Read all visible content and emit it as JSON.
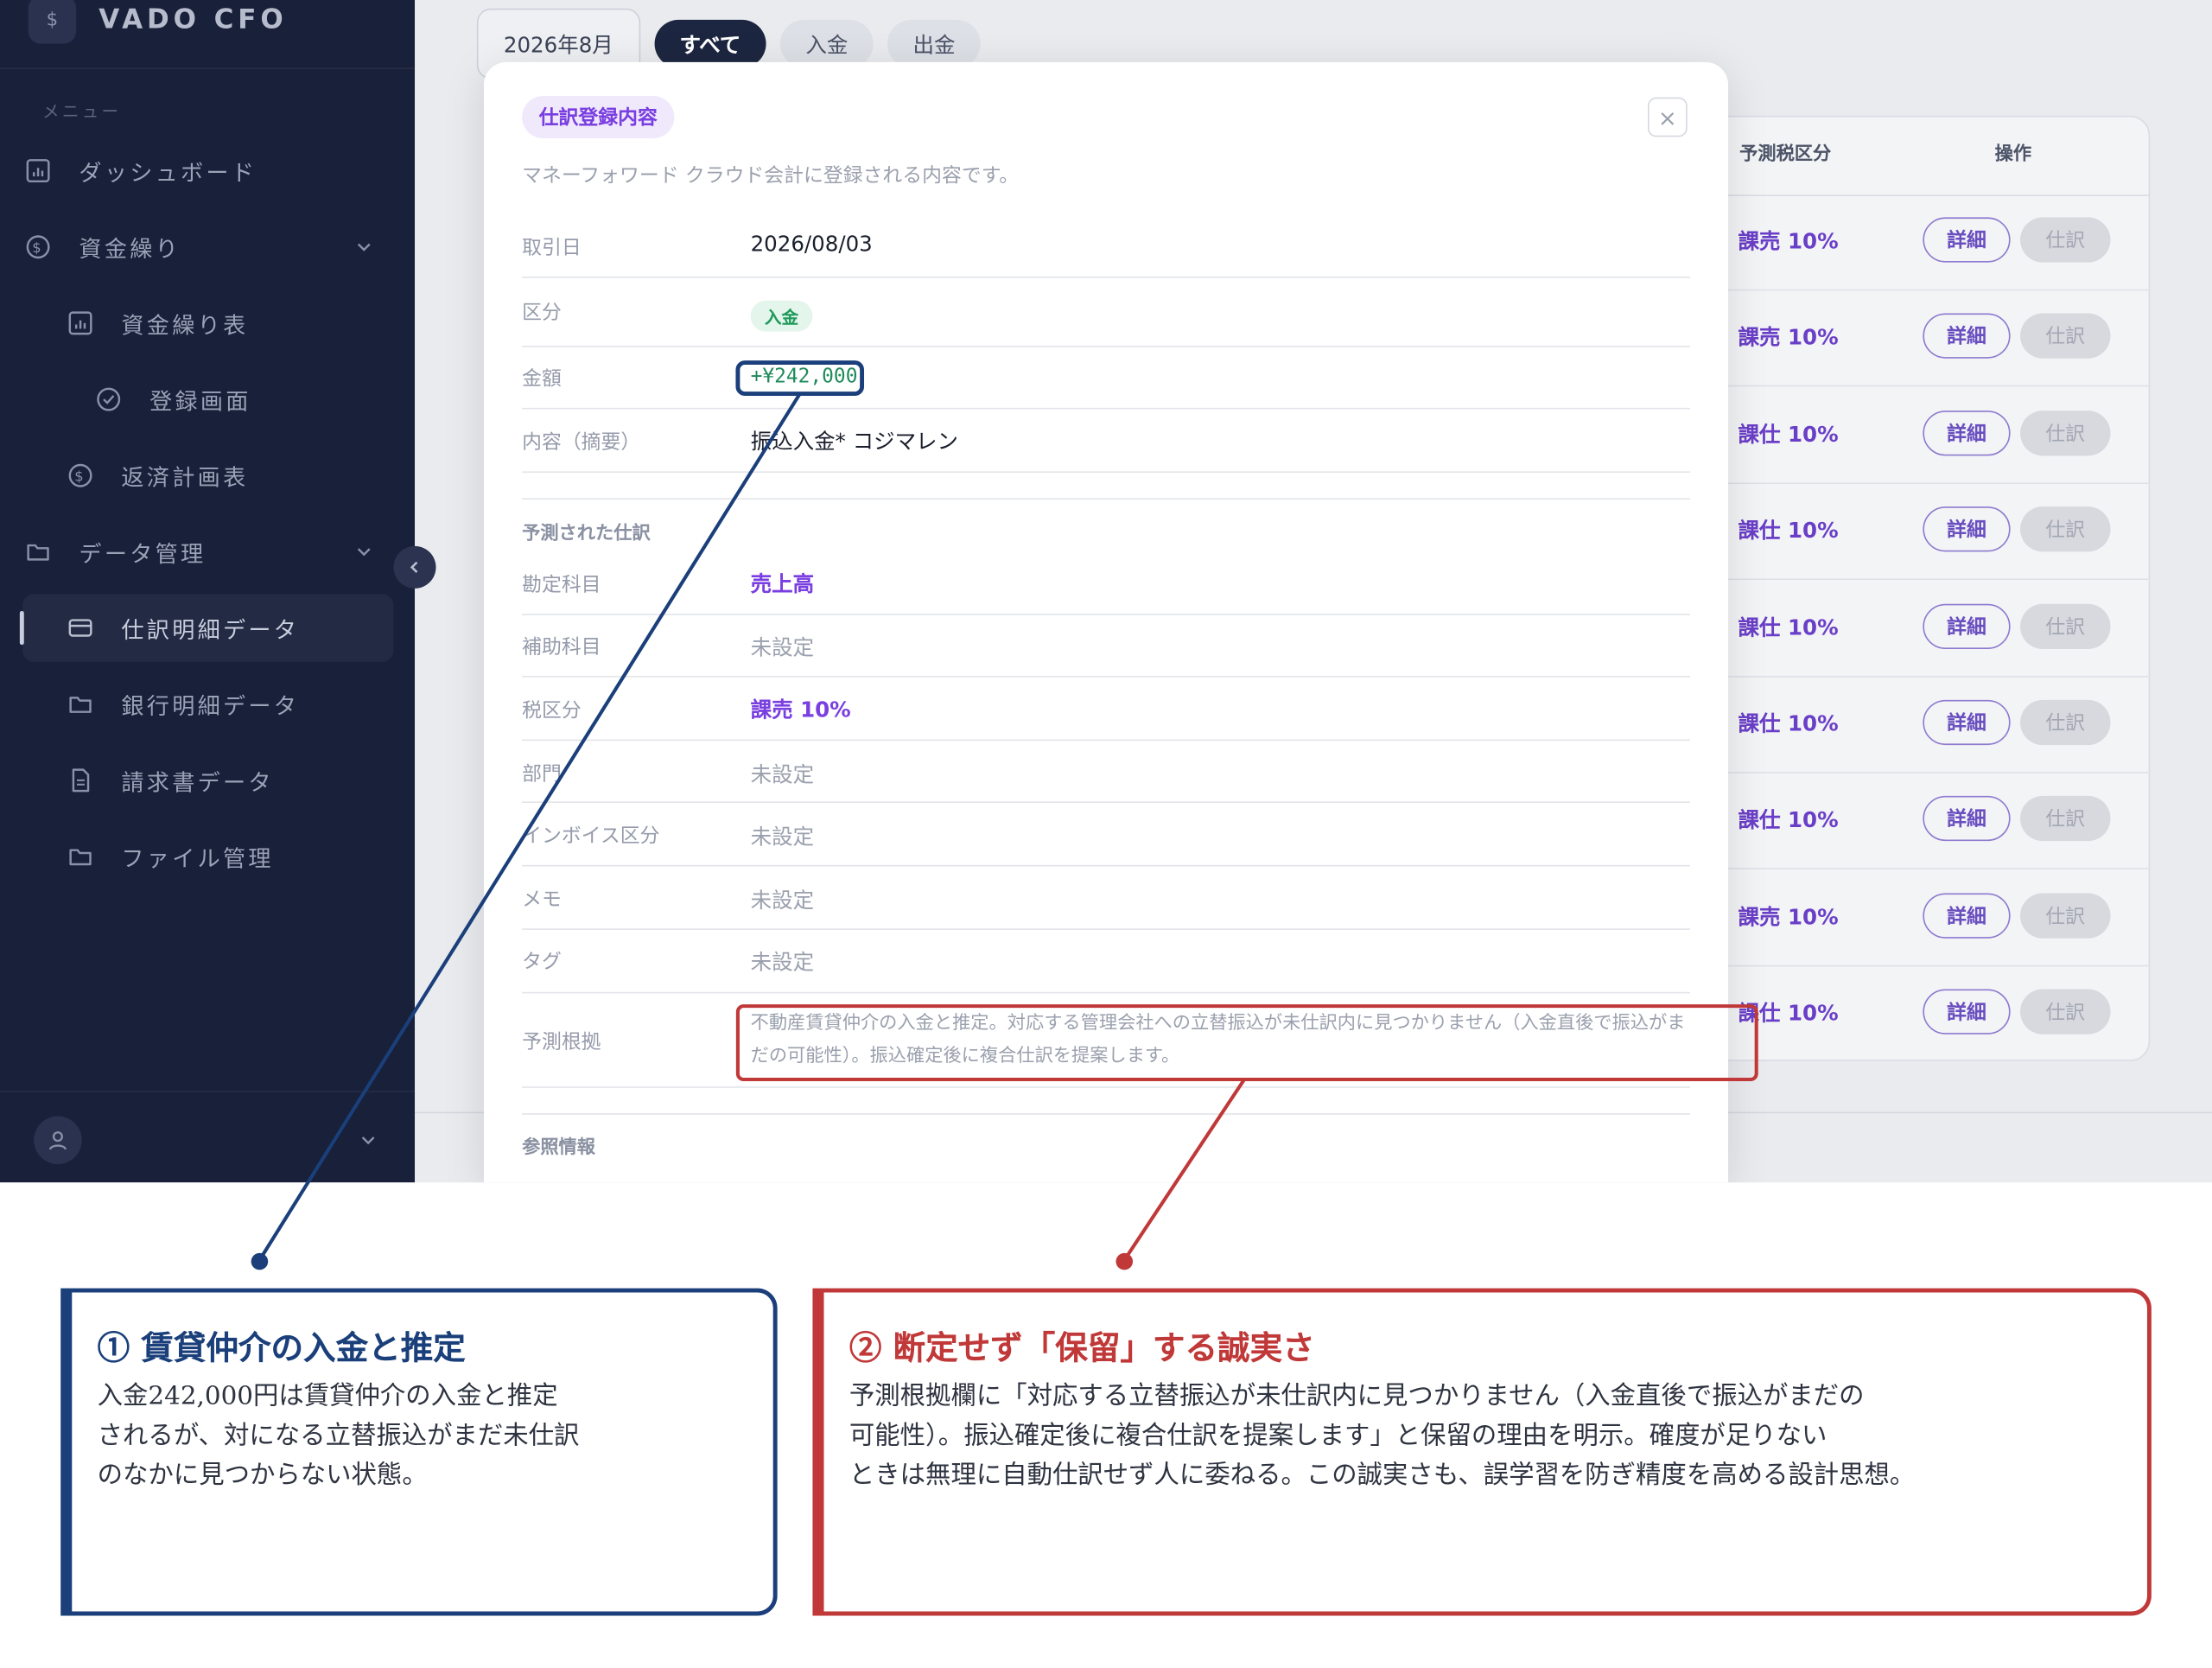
{
  "sidebar": {
    "brand": "VADO CFO",
    "brand_badge": "$",
    "menu_label": "メニュー",
    "items": [
      {
        "label": "ダッシュボード"
      },
      {
        "label": "資金繰り"
      },
      {
        "label": "資金繰り表"
      },
      {
        "label": "登録画面"
      },
      {
        "label": "返済計画表"
      },
      {
        "label": "データ管理"
      },
      {
        "label": "仕訳明細データ"
      },
      {
        "label": "銀行明細データ"
      },
      {
        "label": "請求書データ"
      },
      {
        "label": "ファイル管理"
      }
    ],
    "active_item": "仕訳明細データ"
  },
  "tabs": {
    "month": "2026年8月",
    "filters": [
      "すべて",
      "入金",
      "出金"
    ],
    "selected": "すべて"
  },
  "table": {
    "headers": [
      "予測税区分",
      "操作"
    ],
    "rows": [
      {
        "tax": "課売 10%",
        "detail": "詳細",
        "journal": "仕訳"
      },
      {
        "tax": "課売 10%",
        "detail": "詳細",
        "journal": "仕訳"
      },
      {
        "tax": "課仕 10%",
        "detail": "詳細",
        "journal": "仕訳"
      },
      {
        "tax": "課仕 10%",
        "detail": "詳細",
        "journal": "仕訳"
      },
      {
        "tax": "課仕 10%",
        "detail": "詳細",
        "journal": "仕訳"
      },
      {
        "tax": "課仕 10%",
        "detail": "詳細",
        "journal": "仕訳"
      },
      {
        "tax": "課仕 10%",
        "detail": "詳細",
        "journal": "仕訳"
      },
      {
        "tax": "課売 10%",
        "detail": "詳細",
        "journal": "仕訳"
      },
      {
        "tax": "課仕 10%",
        "detail": "詳細",
        "journal": "仕訳"
      }
    ]
  },
  "modal": {
    "badge": "仕訳登録内容",
    "close": "×",
    "description": "マネーフォワード クラウド会計に登録される内容です。",
    "fields": {
      "date_label": "取引日",
      "date_value": "2026/08/03",
      "kind_label": "区分",
      "kind_value": "入金",
      "amount_label": "金額",
      "amount_value": "+¥242,000",
      "memo_label": "内容（摘要）",
      "memo_value": "振込入金* コジマレン"
    },
    "predicted_section": "予測された仕訳",
    "predicted": {
      "account_label": "勘定科目",
      "account_value": "売上高",
      "sub_label": "補助科目",
      "sub_value": "未設定",
      "tax_label": "税区分",
      "tax_value": "課売 10%",
      "dept_label": "部門",
      "dept_value": "未設定",
      "invoice_label": "インボイス区分",
      "invoice_value": "未設定",
      "memo_label": "メモ",
      "memo_value": "未設定",
      "tag_label": "タグ",
      "tag_value": "未設定",
      "reason_label": "予測根拠",
      "reason_value": "不動産賃貸仲介の入金と推定。対応する管理会社への立替振込が未仕訳内に見つかりません（入金直後で振込がまだの可能性）。振込確定後に複合仕訳を提案します。"
    },
    "reference_section": "参照情報"
  },
  "annotations": {
    "blue": {
      "title": "① 賃貸仲介の入金と推定",
      "body": "入金242,000円は賃貸仲介の入金と推定\nされるが、対になる立替振込がまだ未仕訳\nのなかに見つからない状態。",
      "color": "#1a3f7a"
    },
    "red": {
      "title": "② 断定せず「保留」する誠実さ",
      "body": "予測根拠欄に「対応する立替振込が未仕訳内に見つかりません（入金直後で振込がまだの\n可能性）。振込確定後に複合仕訳を提案します」と保留の理由を明示。確度が足りない\nときは無理に自動仕訳せず人に委ねる。この誠実さも、誤学習を防ぎ精度を高める設計思想。",
      "color": "#c03838"
    }
  }
}
